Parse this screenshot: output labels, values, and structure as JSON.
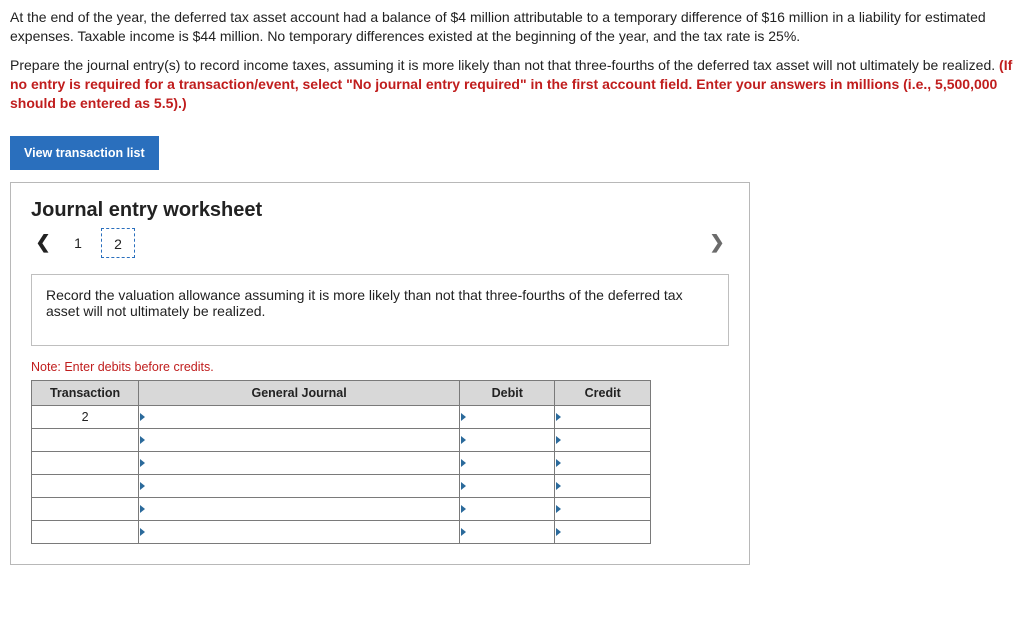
{
  "problem": {
    "para1": "At the end of the year, the deferred tax asset account had a balance of $4 million attributable to a temporary difference of $16 million in a liability for estimated expenses. Taxable income is $44 million. No temporary differences existed at the beginning of the year, and the tax rate is 25%.",
    "para2_plain": "Prepare the journal entry(s) to record income taxes, assuming it is more likely than not that three-fourths of the deferred tax asset will not ultimately be realized. ",
    "para2_red": "(If no entry is required for a transaction/event, select \"No journal entry required\" in the first account field. Enter your answers in millions (i.e., 5,500,000 should be entered as 5.5).)"
  },
  "view_button": "View transaction list",
  "worksheet": {
    "title": "Journal entry worksheet",
    "steps": [
      "1",
      "2"
    ],
    "active_step_index": 1,
    "instruction": "Record the valuation allowance assuming it is more likely than not that three-fourths of the deferred tax asset will not ultimately be realized.",
    "note": "Note: Enter debits before credits.",
    "columns": {
      "transaction": "Transaction",
      "general_journal": "General Journal",
      "debit": "Debit",
      "credit": "Credit"
    },
    "rows": [
      {
        "transaction": "2",
        "journal": "",
        "debit": "",
        "credit": ""
      },
      {
        "transaction": "",
        "journal": "",
        "debit": "",
        "credit": ""
      },
      {
        "transaction": "",
        "journal": "",
        "debit": "",
        "credit": ""
      },
      {
        "transaction": "",
        "journal": "",
        "debit": "",
        "credit": ""
      },
      {
        "transaction": "",
        "journal": "",
        "debit": "",
        "credit": ""
      },
      {
        "transaction": "",
        "journal": "",
        "debit": "",
        "credit": ""
      }
    ]
  }
}
